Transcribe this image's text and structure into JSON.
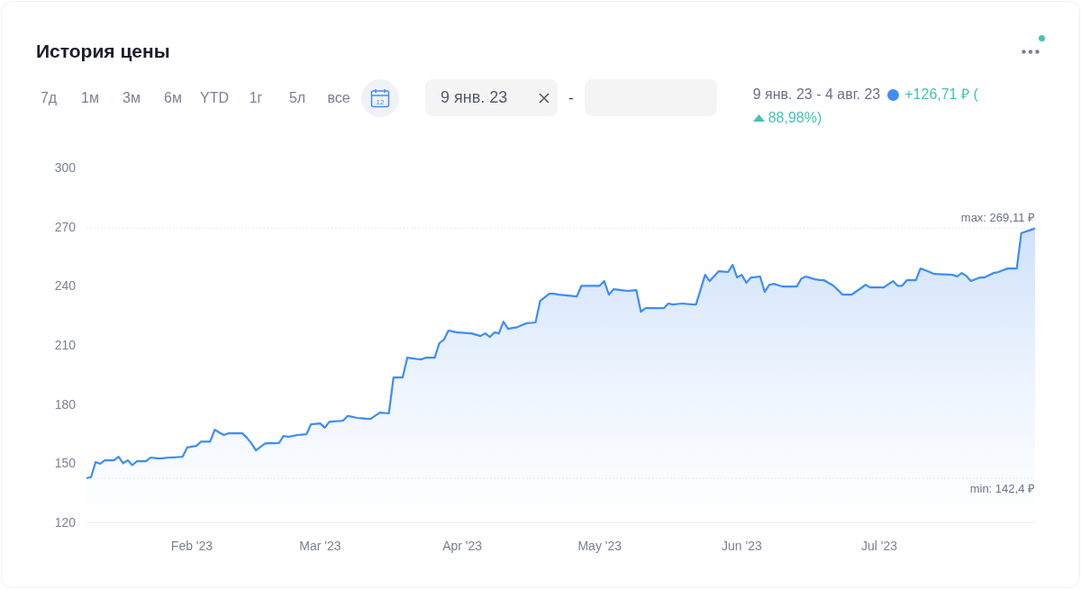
{
  "title": "История цены",
  "periods": [
    {
      "label": "7д",
      "selected": false
    },
    {
      "label": "1м",
      "selected": false
    },
    {
      "label": "3м",
      "selected": false
    },
    {
      "label": "6м",
      "selected": false
    },
    {
      "label": "YTD",
      "selected": false
    },
    {
      "label": "1г",
      "selected": false
    },
    {
      "label": "5л",
      "selected": false
    },
    {
      "label": "все",
      "selected": false
    }
  ],
  "calendar_button": {
    "selected": true,
    "day": "12"
  },
  "date_from": {
    "value": "9 янв. 23"
  },
  "separator": "-",
  "summary": {
    "range": "9 янв. 23 - 4 авг. 23",
    "change": "+126,71 ₽ (",
    "percent": "88,98%)"
  },
  "chart": {
    "max_label": "max: 269,11 ₽",
    "min_label": "min: 142,4 ₽",
    "chart_data": {
      "type": "area",
      "ylim": [
        120,
        300
      ],
      "yticks": [
        120,
        150,
        180,
        210,
        240,
        270,
        300
      ],
      "categories": [
        null,
        null,
        null,
        null,
        null,
        null,
        null,
        null,
        null,
        null,
        null,
        null,
        null,
        null,
        null,
        null,
        null,
        null,
        null,
        null,
        null,
        null,
        null,
        "Feb '23",
        null,
        null,
        null,
        null,
        null,
        null,
        null,
        null,
        null,
        null,
        null,
        null,
        null,
        null,
        null,
        null,
        null,
        null,
        null,
        null,
        null,
        null,
        null,
        null,
        null,
        null,
        null,
        "Mar '23",
        null,
        null,
        null,
        null,
        null,
        null,
        null,
        null,
        null,
        null,
        null,
        null,
        null,
        null,
        null,
        null,
        null,
        null,
        null,
        null,
        null,
        null,
        null,
        null,
        null,
        null,
        null,
        null,
        null,
        null,
        "Apr '23",
        null,
        null,
        null,
        null,
        null,
        null,
        null,
        null,
        null,
        null,
        null,
        null,
        null,
        null,
        null,
        null,
        null,
        null,
        null,
        null,
        null,
        null,
        null,
        null,
        null,
        null,
        null,
        null,
        null,
        "May '23",
        null,
        null,
        null,
        null,
        null,
        null,
        null,
        null,
        null,
        null,
        null,
        null,
        null,
        null,
        null,
        null,
        null,
        null,
        null,
        null,
        null,
        null,
        null,
        null,
        null,
        null,
        null,
        null,
        null,
        null,
        "Jun '23",
        null,
        null,
        null,
        null,
        null,
        null,
        null,
        null,
        null,
        null,
        null,
        null,
        null,
        null,
        null,
        null,
        null,
        null,
        null,
        null,
        null,
        null,
        null,
        null,
        null,
        null,
        null,
        null,
        null,
        "Jul '23",
        null,
        null,
        null,
        null,
        null,
        null,
        null,
        null,
        null,
        null,
        null,
        null,
        null,
        null,
        null,
        null,
        null,
        null,
        null,
        null,
        null,
        null,
        null,
        null,
        null,
        null,
        null,
        null,
        null,
        null,
        null,
        null,
        null,
        null
      ],
      "series": [
        {
          "color": "#3d8ef5",
          "values": [
            142.4,
            143,
            150.6,
            149.7,
            151.5,
            151.5,
            151.5,
            153.3,
            150,
            151.5,
            149,
            151,
            151,
            151,
            152.9,
            152.6,
            152.4,
            152.6,
            152.9,
            153,
            153.1,
            153.3,
            158,
            158.4,
            158.8,
            161,
            161,
            161,
            167,
            165.6,
            164.3,
            165.2,
            165.2,
            165.2,
            165.2,
            163,
            160,
            156.5,
            158.3,
            160,
            160.1,
            160.1,
            160.2,
            163.8,
            163.4,
            163.8,
            164.3,
            164.5,
            164.7,
            169.8,
            170,
            170.2,
            168,
            171,
            171.2,
            171.4,
            171.6,
            174,
            173.5,
            173,
            172.8,
            172.6,
            172.5,
            174.1,
            175.7,
            175.5,
            175.3,
            193.5,
            193.5,
            193.5,
            203.5,
            203.2,
            202.9,
            202.6,
            203.5,
            203.5,
            203.5,
            210.9,
            212.7,
            217.3,
            216.8,
            216.3,
            216.2,
            216,
            215.9,
            215.2,
            214.5,
            215.9,
            214,
            216.3,
            215.9,
            221.8,
            218.2,
            218.6,
            219,
            220,
            221,
            221.2,
            221.4,
            232.3,
            234.1,
            236,
            236,
            235.5,
            235.3,
            235.1,
            234.8,
            234.6,
            240,
            240,
            240,
            240,
            240,
            242.4,
            235.5,
            238.3,
            238,
            237.7,
            237.4,
            237.6,
            237.8,
            226.8,
            228.7,
            228.7,
            228.7,
            228.7,
            228.7,
            231,
            230.5,
            230.8,
            231,
            230.8,
            230.6,
            230.5,
            238,
            245.6,
            242.4,
            244.9,
            247.4,
            247.2,
            247,
            250.6,
            244.2,
            245.6,
            241.5,
            244.2,
            244.4,
            244.7,
            236.9,
            240.5,
            241,
            240.3,
            239.6,
            239.6,
            239.6,
            239.6,
            243.7,
            244.7,
            244,
            243.3,
            243,
            242.8,
            241.4,
            240,
            237.8,
            235.5,
            235.5,
            235.5,
            237.2,
            238.8,
            240.5,
            239.2,
            239.2,
            239.2,
            239.2,
            240.8,
            242.4,
            240,
            240,
            242.8,
            242.8,
            242.8,
            248.8,
            247.9,
            247,
            246,
            245.9,
            245.8,
            245.7,
            245.6,
            244.7,
            246.5,
            245,
            242.4,
            243.3,
            244.2,
            244.2,
            245.4,
            246.5,
            247,
            247.9,
            248.8,
            248.8,
            248.8,
            266.6,
            267.5,
            268.3,
            269.1
          ]
        }
      ]
    }
  }
}
